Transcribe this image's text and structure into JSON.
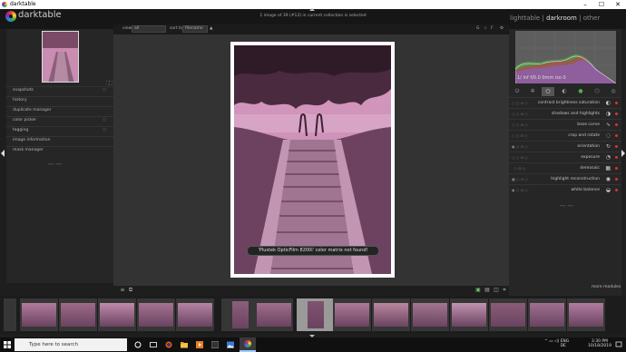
{
  "window": {
    "title": "darktable"
  },
  "header": {
    "logo_text": "darktable",
    "image_count": "1 image of 39 (#13) in current collection is selected",
    "views": {
      "lighttable": "lighttable",
      "darkroom": "darkroom",
      "other": "other",
      "sep": "|"
    }
  },
  "filter": {
    "view_label": "view",
    "view_value": "all",
    "sortby_label": "sort by",
    "sortby_value": "filename"
  },
  "left_modules": [
    {
      "label": "snapshots"
    },
    {
      "label": "history"
    },
    {
      "label": "duplicate manager"
    },
    {
      "label": "color picker"
    },
    {
      "label": "tagging"
    },
    {
      "label": "image information"
    },
    {
      "label": "mask manager"
    }
  ],
  "histogram": {
    "exif": "1/ inf f/0.0 0mm iso 0"
  },
  "right_modules": [
    {
      "label": "contrast brightness saturation",
      "icon": "◐"
    },
    {
      "label": "shadows and highlights",
      "icon": "◑"
    },
    {
      "label": "base curve",
      "icon": "∿"
    },
    {
      "label": "crop and rotate",
      "icon": "◌"
    },
    {
      "label": "orientation",
      "icon": "↻"
    },
    {
      "label": "exposure",
      "icon": "◔"
    },
    {
      "label": "demosaic",
      "icon": "▦"
    },
    {
      "label": "highlight reconstruction",
      "icon": "◉"
    },
    {
      "label": "white balance",
      "icon": "◒"
    }
  ],
  "more_modules": "more modules",
  "toast": "'Plustek OpticFilm 8200i' color matrix not found!",
  "taskbar": {
    "search_placeholder": "Type here to search",
    "lang": "ENG",
    "region": "DE",
    "time": "3:30 PM",
    "date": "10/18/2019"
  },
  "colors": {
    "pink_tone": "#c07fa5",
    "accent_red": "#d33333",
    "panel": "#262626"
  }
}
